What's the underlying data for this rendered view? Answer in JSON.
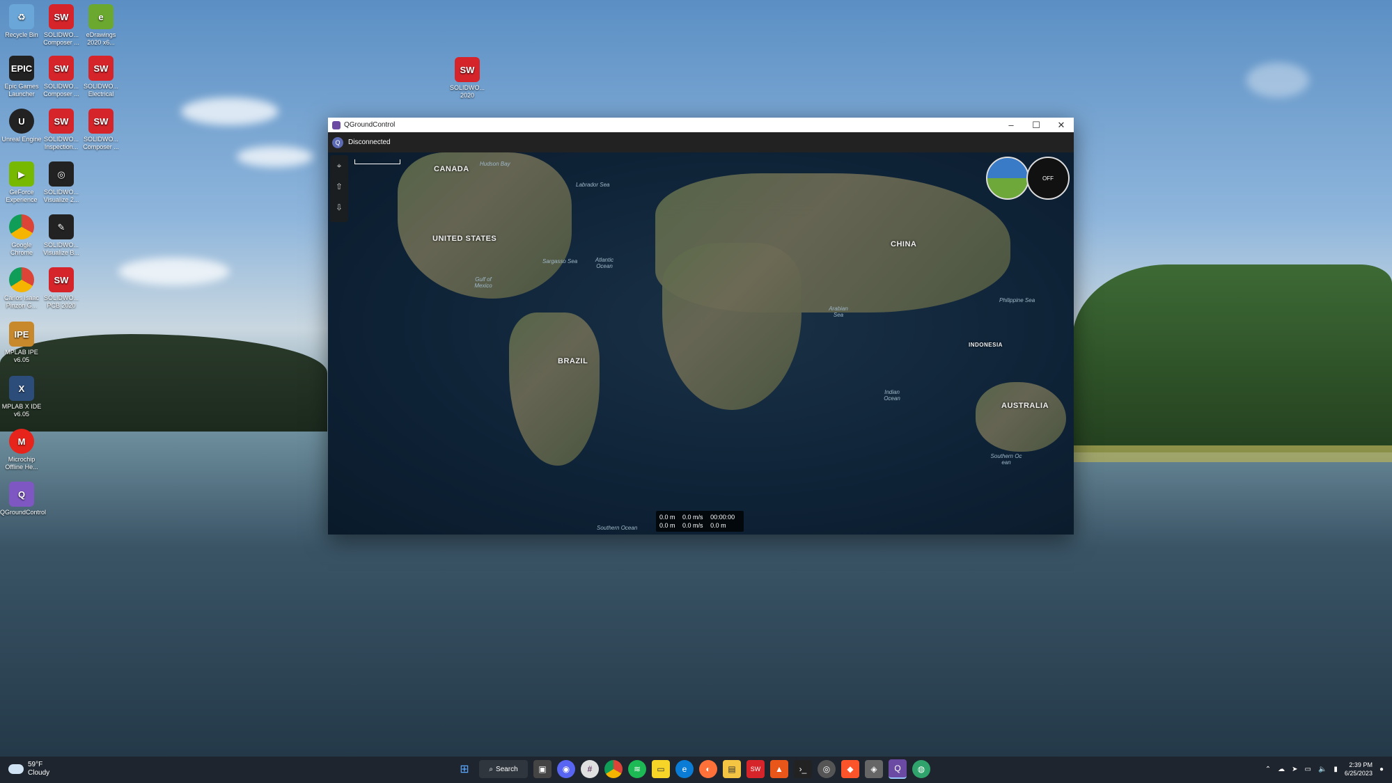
{
  "desktop": {
    "icons": [
      {
        "label": "Recycle Bin"
      },
      {
        "label": "SOLIDWO... Composer ..."
      },
      {
        "label": "eDrawings 2020 x6..."
      },
      {
        "label": "Epic Games Launcher"
      },
      {
        "label": "SOLIDWO... Composer ..."
      },
      {
        "label": "SOLIDWO... Electrical"
      },
      {
        "label": "Unreal Engine"
      },
      {
        "label": "SOLIDWO... Inspection..."
      },
      {
        "label": "SOLIDWO... Composer ..."
      },
      {
        "label": "GeForce Experience"
      },
      {
        "label": "SOLIDWO... Visualize 2..."
      },
      {
        "label": "Google Chrome"
      },
      {
        "label": "SOLIDWO... Visualize B..."
      },
      {
        "label": "Carlos Isaac Pinzon G..."
      },
      {
        "label": "SOLIDWO... PCB 2020"
      },
      {
        "label": "MPLAB IPE v6.05"
      },
      {
        "label": "MPLAB X IDE v6.05"
      },
      {
        "label": "Microchip Offline He..."
      },
      {
        "label": "QGroundControl"
      },
      {
        "label": "SOLIDWO... 2020"
      }
    ]
  },
  "window": {
    "title": "QGroundControl",
    "minimize": "–",
    "maximize": "☐",
    "close": "✕"
  },
  "toolbar": {
    "status": "Disconnected"
  },
  "map": {
    "labels": [
      "CANADA",
      "UNITED STATES",
      "BRAZIL",
      "CHINA",
      "AUSTRALIA",
      "INDONESIA"
    ],
    "seas": [
      "Labrador Sea",
      "Hudson Bay",
      "Sargasso Sea",
      "Atlantic Ocean",
      "Gulf of Mexico",
      "Indian Ocean",
      "Southern Ocean",
      "Southern Oc ean",
      "Arabian Sea",
      "Philippine Sea"
    ],
    "tools": [
      "Fly",
      "Takeoff",
      "Return"
    ],
    "compass_text": "OFF"
  },
  "telemetry": {
    "row1": [
      "0.0 m",
      "0.0 m/s",
      "00:00:00"
    ],
    "row2": [
      "0.0 m",
      "0.0 m/s",
      "0.0 m"
    ]
  },
  "taskbar": {
    "temp": "59°F",
    "weather": "Cloudy",
    "search": "Search",
    "time": "2:39 PM",
    "date": "6/25/2023"
  }
}
